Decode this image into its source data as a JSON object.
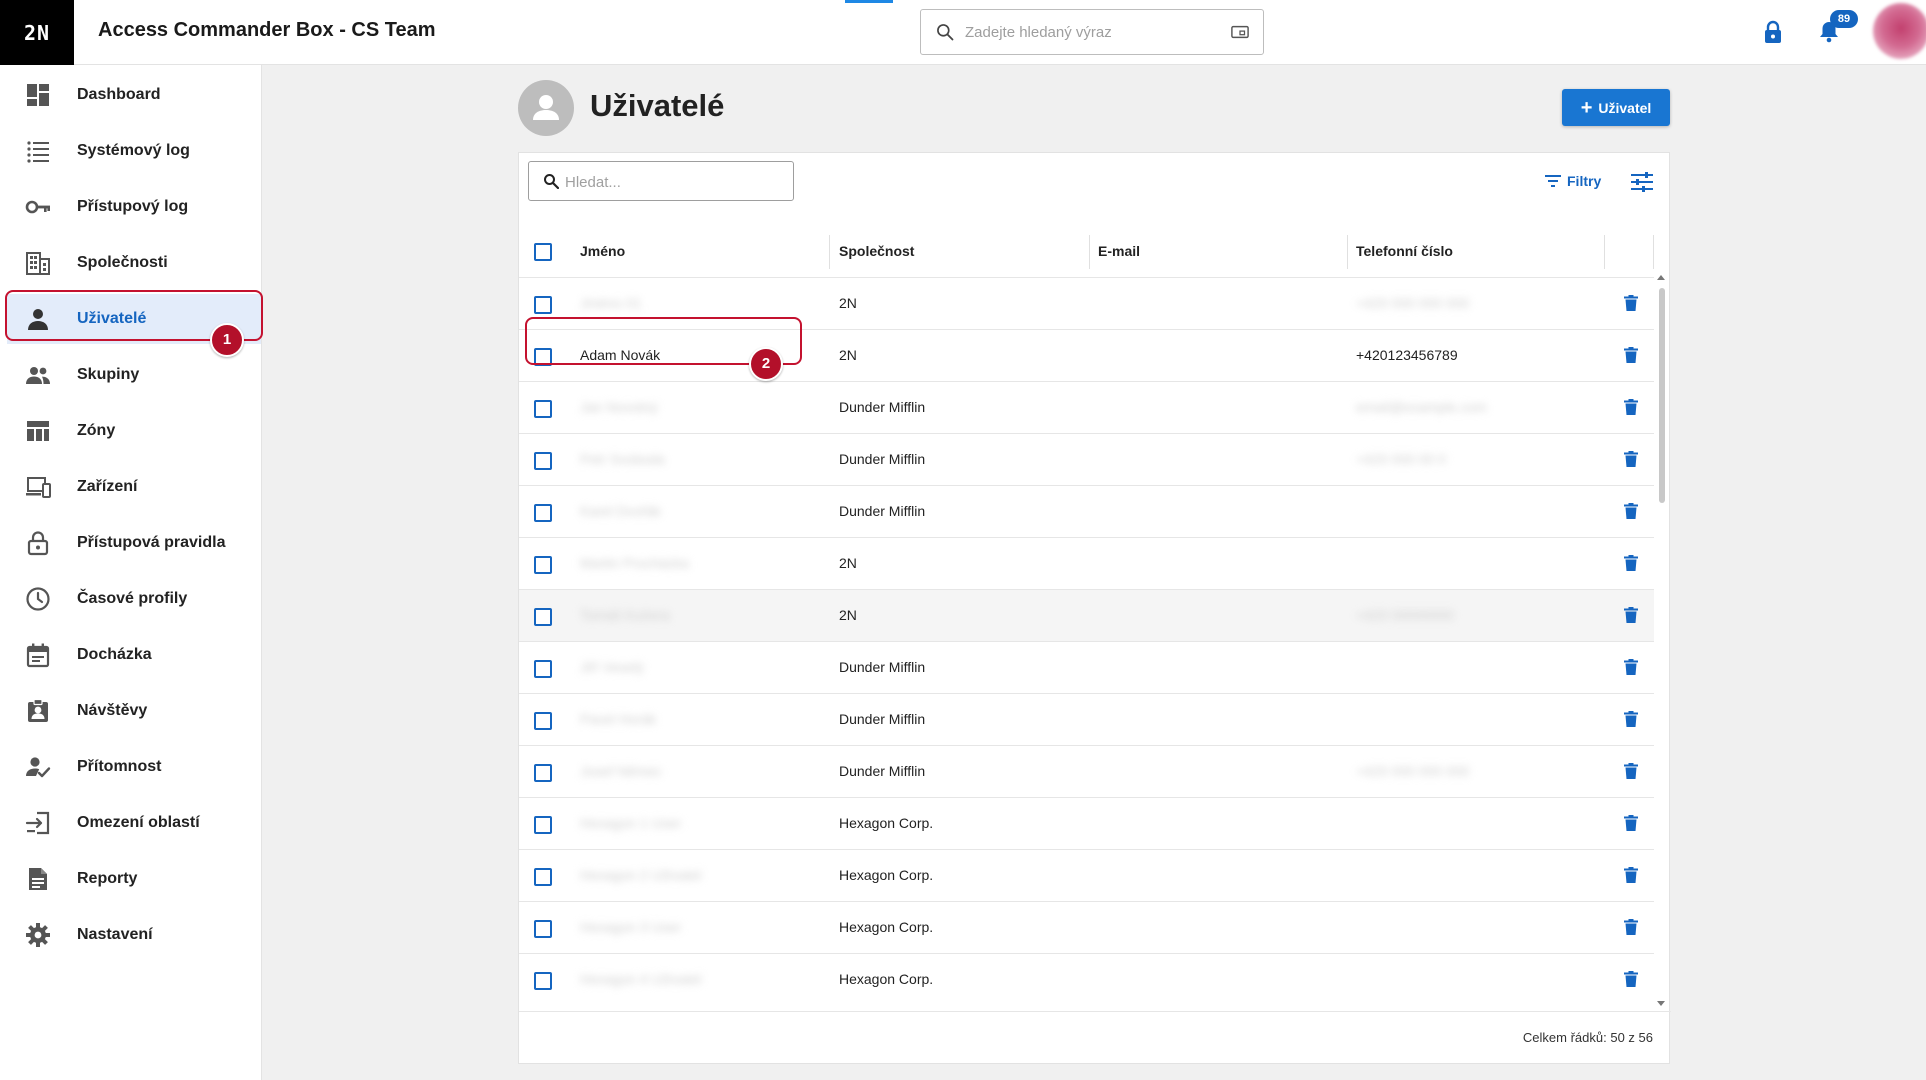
{
  "header": {
    "logo_text": "2N",
    "app_title": "Access Commander Box - CS Team",
    "search_placeholder": "Zadejte hledaný výraz",
    "notification_count": "89"
  },
  "sidebar": {
    "items": [
      {
        "label": "Dashboard",
        "icon": "dashboard-icon",
        "active": false
      },
      {
        "label": "Systémový log",
        "icon": "list-icon",
        "active": false
      },
      {
        "label": "Přístupový log",
        "icon": "key-icon",
        "active": false
      },
      {
        "label": "Společnosti",
        "icon": "building-icon",
        "active": false
      },
      {
        "label": "Uživatelé",
        "icon": "person-icon",
        "active": true
      },
      {
        "label": "Skupiny",
        "icon": "group-icon",
        "active": false
      },
      {
        "label": "Zóny",
        "icon": "zones-icon",
        "active": false
      },
      {
        "label": "Zařízení",
        "icon": "devices-icon",
        "active": false
      },
      {
        "label": "Přístupová pravidla",
        "icon": "lock-open-icon",
        "active": false
      },
      {
        "label": "Časové profily",
        "icon": "clock-icon",
        "active": false
      },
      {
        "label": "Docházka",
        "icon": "calendar-icon",
        "active": false
      },
      {
        "label": "Návštěvy",
        "icon": "visitor-badge-icon",
        "active": false
      },
      {
        "label": "Přítomnost",
        "icon": "person-check-icon",
        "active": false
      },
      {
        "label": "Omezení oblastí",
        "icon": "area-restriction-icon",
        "active": false
      },
      {
        "label": "Reporty",
        "icon": "report-icon",
        "active": false
      },
      {
        "label": "Nastavení",
        "icon": "gear-icon",
        "active": false
      }
    ]
  },
  "page": {
    "title": "Uživatelé",
    "add_button_label": "Uživatel",
    "table_search_placeholder": "Hledat...",
    "filters_label": "Filtry"
  },
  "table": {
    "columns": [
      "Jméno",
      "Společnost",
      "E-mail",
      "Telefonní číslo"
    ],
    "rows": [
      {
        "name": "Jméno 01",
        "name_hidden": true,
        "company": "2N",
        "email": "",
        "phone": "+420 000 000 000",
        "phone_hidden": true
      },
      {
        "name": "Adam Novák",
        "name_hidden": false,
        "company": "2N",
        "email": "",
        "phone": "+420123456789",
        "phone_hidden": false
      },
      {
        "name": "Jan Novotný",
        "name_hidden": true,
        "company": "Dunder Mifflin",
        "email": "",
        "phone": "email@example.com",
        "phone_hidden": true
      },
      {
        "name": "Petr Svoboda",
        "name_hidden": true,
        "company": "Dunder Mifflin",
        "email": "",
        "phone": "+420 000 00 0",
        "phone_hidden": true
      },
      {
        "name": "Karel Dvořák",
        "name_hidden": true,
        "company": "Dunder Mifflin",
        "email": "",
        "phone": "",
        "phone_hidden": false
      },
      {
        "name": "Martin Procházka",
        "name_hidden": true,
        "company": "2N",
        "email": "",
        "phone": "",
        "phone_hidden": false
      },
      {
        "name": "Tomáš Kučera",
        "name_hidden": true,
        "company": "2N",
        "email": "",
        "phone": "+420 00000000",
        "phone_hidden": true
      },
      {
        "name": "Jiří Veselý",
        "name_hidden": true,
        "company": "Dunder Mifflin",
        "email": "",
        "phone": "",
        "phone_hidden": false
      },
      {
        "name": "Pavel Horák",
        "name_hidden": true,
        "company": "Dunder Mifflin",
        "email": "",
        "phone": "",
        "phone_hidden": false
      },
      {
        "name": "Josef Němec",
        "name_hidden": true,
        "company": "Dunder Mifflin",
        "email": "",
        "phone": "+420 000 000 000",
        "phone_hidden": true
      },
      {
        "name": "Hexagon 1 User",
        "name_hidden": true,
        "company": "Hexagon Corp.",
        "email": "",
        "phone": "",
        "phone_hidden": false
      },
      {
        "name": "Hexagon 2 Uživatel",
        "name_hidden": true,
        "company": "Hexagon Corp.",
        "email": "",
        "phone": "",
        "phone_hidden": false
      },
      {
        "name": "Hexagon 3 User",
        "name_hidden": true,
        "company": "Hexagon Corp.",
        "email": "",
        "phone": "",
        "phone_hidden": false
      },
      {
        "name": "Hexagon 4 Uživatel",
        "name_hidden": true,
        "company": "Hexagon Corp.",
        "email": "",
        "phone": "",
        "phone_hidden": false
      }
    ],
    "footer_text": "Celkem řádků: 50 z 56"
  },
  "annotations": {
    "step_1": "1",
    "step_2": "2"
  },
  "colors": {
    "accent": "#1976d2",
    "accent_dark": "#1565c0",
    "highlight": "#c4122f",
    "active_nav_bg": "#e3ecfa"
  }
}
